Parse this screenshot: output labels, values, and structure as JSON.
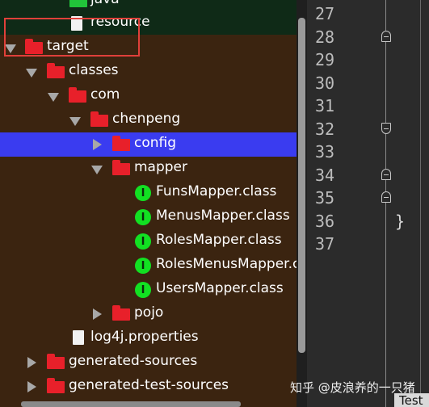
{
  "tree": {
    "items": [
      {
        "label": "java"
      },
      {
        "label": "resource"
      },
      {
        "label": "target"
      },
      {
        "label": "classes"
      },
      {
        "label": "com"
      },
      {
        "label": "chenpeng"
      },
      {
        "label": "config"
      },
      {
        "label": "mapper"
      },
      {
        "label": "FunsMapper.class"
      },
      {
        "label": "MenusMapper.class"
      },
      {
        "label": "RolesMapper.class"
      },
      {
        "label": "RolesMenusMapper.class"
      },
      {
        "label": "UsersMapper.class"
      },
      {
        "label": "pojo"
      },
      {
        "label": "log4j.properties"
      },
      {
        "label": "generated-sources"
      },
      {
        "label": "generated-test-sources"
      }
    ],
    "interface_badge": "I"
  },
  "editor": {
    "line_numbers": [
      "27",
      "28",
      "29",
      "30",
      "31",
      "32",
      "33",
      "34",
      "35",
      "36",
      "37"
    ],
    "code_brace": "}"
  },
  "watermark": "知乎 @皮浪养的一只猪",
  "bottom_tab_label": "Test",
  "colors": {
    "tree_background": "#3b2410",
    "selection": "#3a3cf0",
    "folder": "#e8202a",
    "interface_icon": "#12e022",
    "highlight_box": "#e0403a",
    "editor_background": "#2b2b2b"
  }
}
